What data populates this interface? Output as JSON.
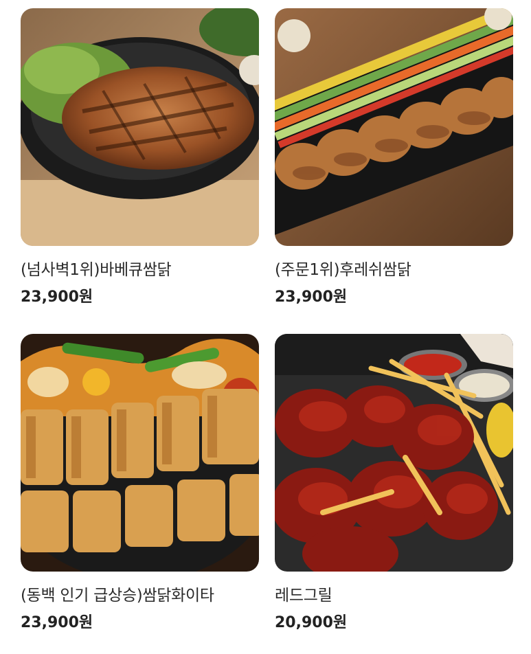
{
  "products": [
    {
      "name": "(넘사벽1위)바베큐쌈닭",
      "price": "23,900원",
      "image_alt": "grilled barbecue chicken on hot plate with greens"
    },
    {
      "name": "(주문1위)후레쉬쌈닭",
      "price": "23,900원",
      "image_alt": "sliced chicken platter with colorful vegetable sticks"
    },
    {
      "name": "(동백 인기 급상승)쌈닭화이타",
      "price": "23,900원",
      "image_alt": "chicken fajita with peppers and onions on skillet"
    },
    {
      "name": "레드그릴",
      "price": "20,900원",
      "image_alt": "red glazed grilled chicken with fries and sauces"
    }
  ]
}
